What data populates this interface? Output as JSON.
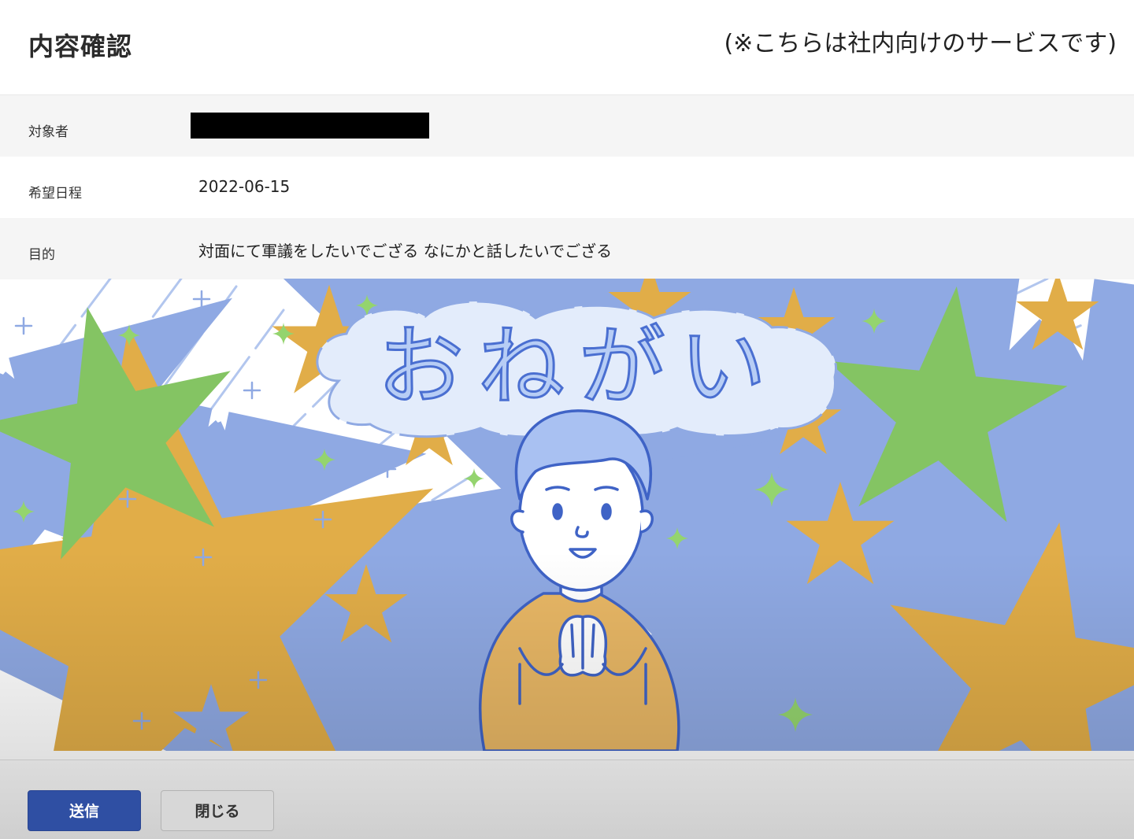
{
  "header": {
    "title": "内容確認",
    "notice": "(※こちらは社内向けのサービスです)"
  },
  "details": {
    "target_label": "対象者",
    "date_label": "希望日程",
    "date_value": "2022-06-15",
    "purpose_label": "目的",
    "purpose_value": "対面にて軍議をしたいでござる なにかと話したいでござる"
  },
  "illustration": {
    "text": "おねがい",
    "colors": {
      "line": "#4a6fd1",
      "cloud": "#e3ecfb",
      "skin": "#ffffff",
      "hair": "#a9c1f2",
      "shirt": "#e8b765",
      "star_yellow": "#f0c76a",
      "star_green": "#9dd97a",
      "star_blue": "#e2eafa"
    }
  },
  "footer": {
    "send_label": "送信",
    "close_label": "閉じる"
  },
  "colors": {
    "primary": "#2f4fa3",
    "row_shade": "#f5f5f5"
  }
}
